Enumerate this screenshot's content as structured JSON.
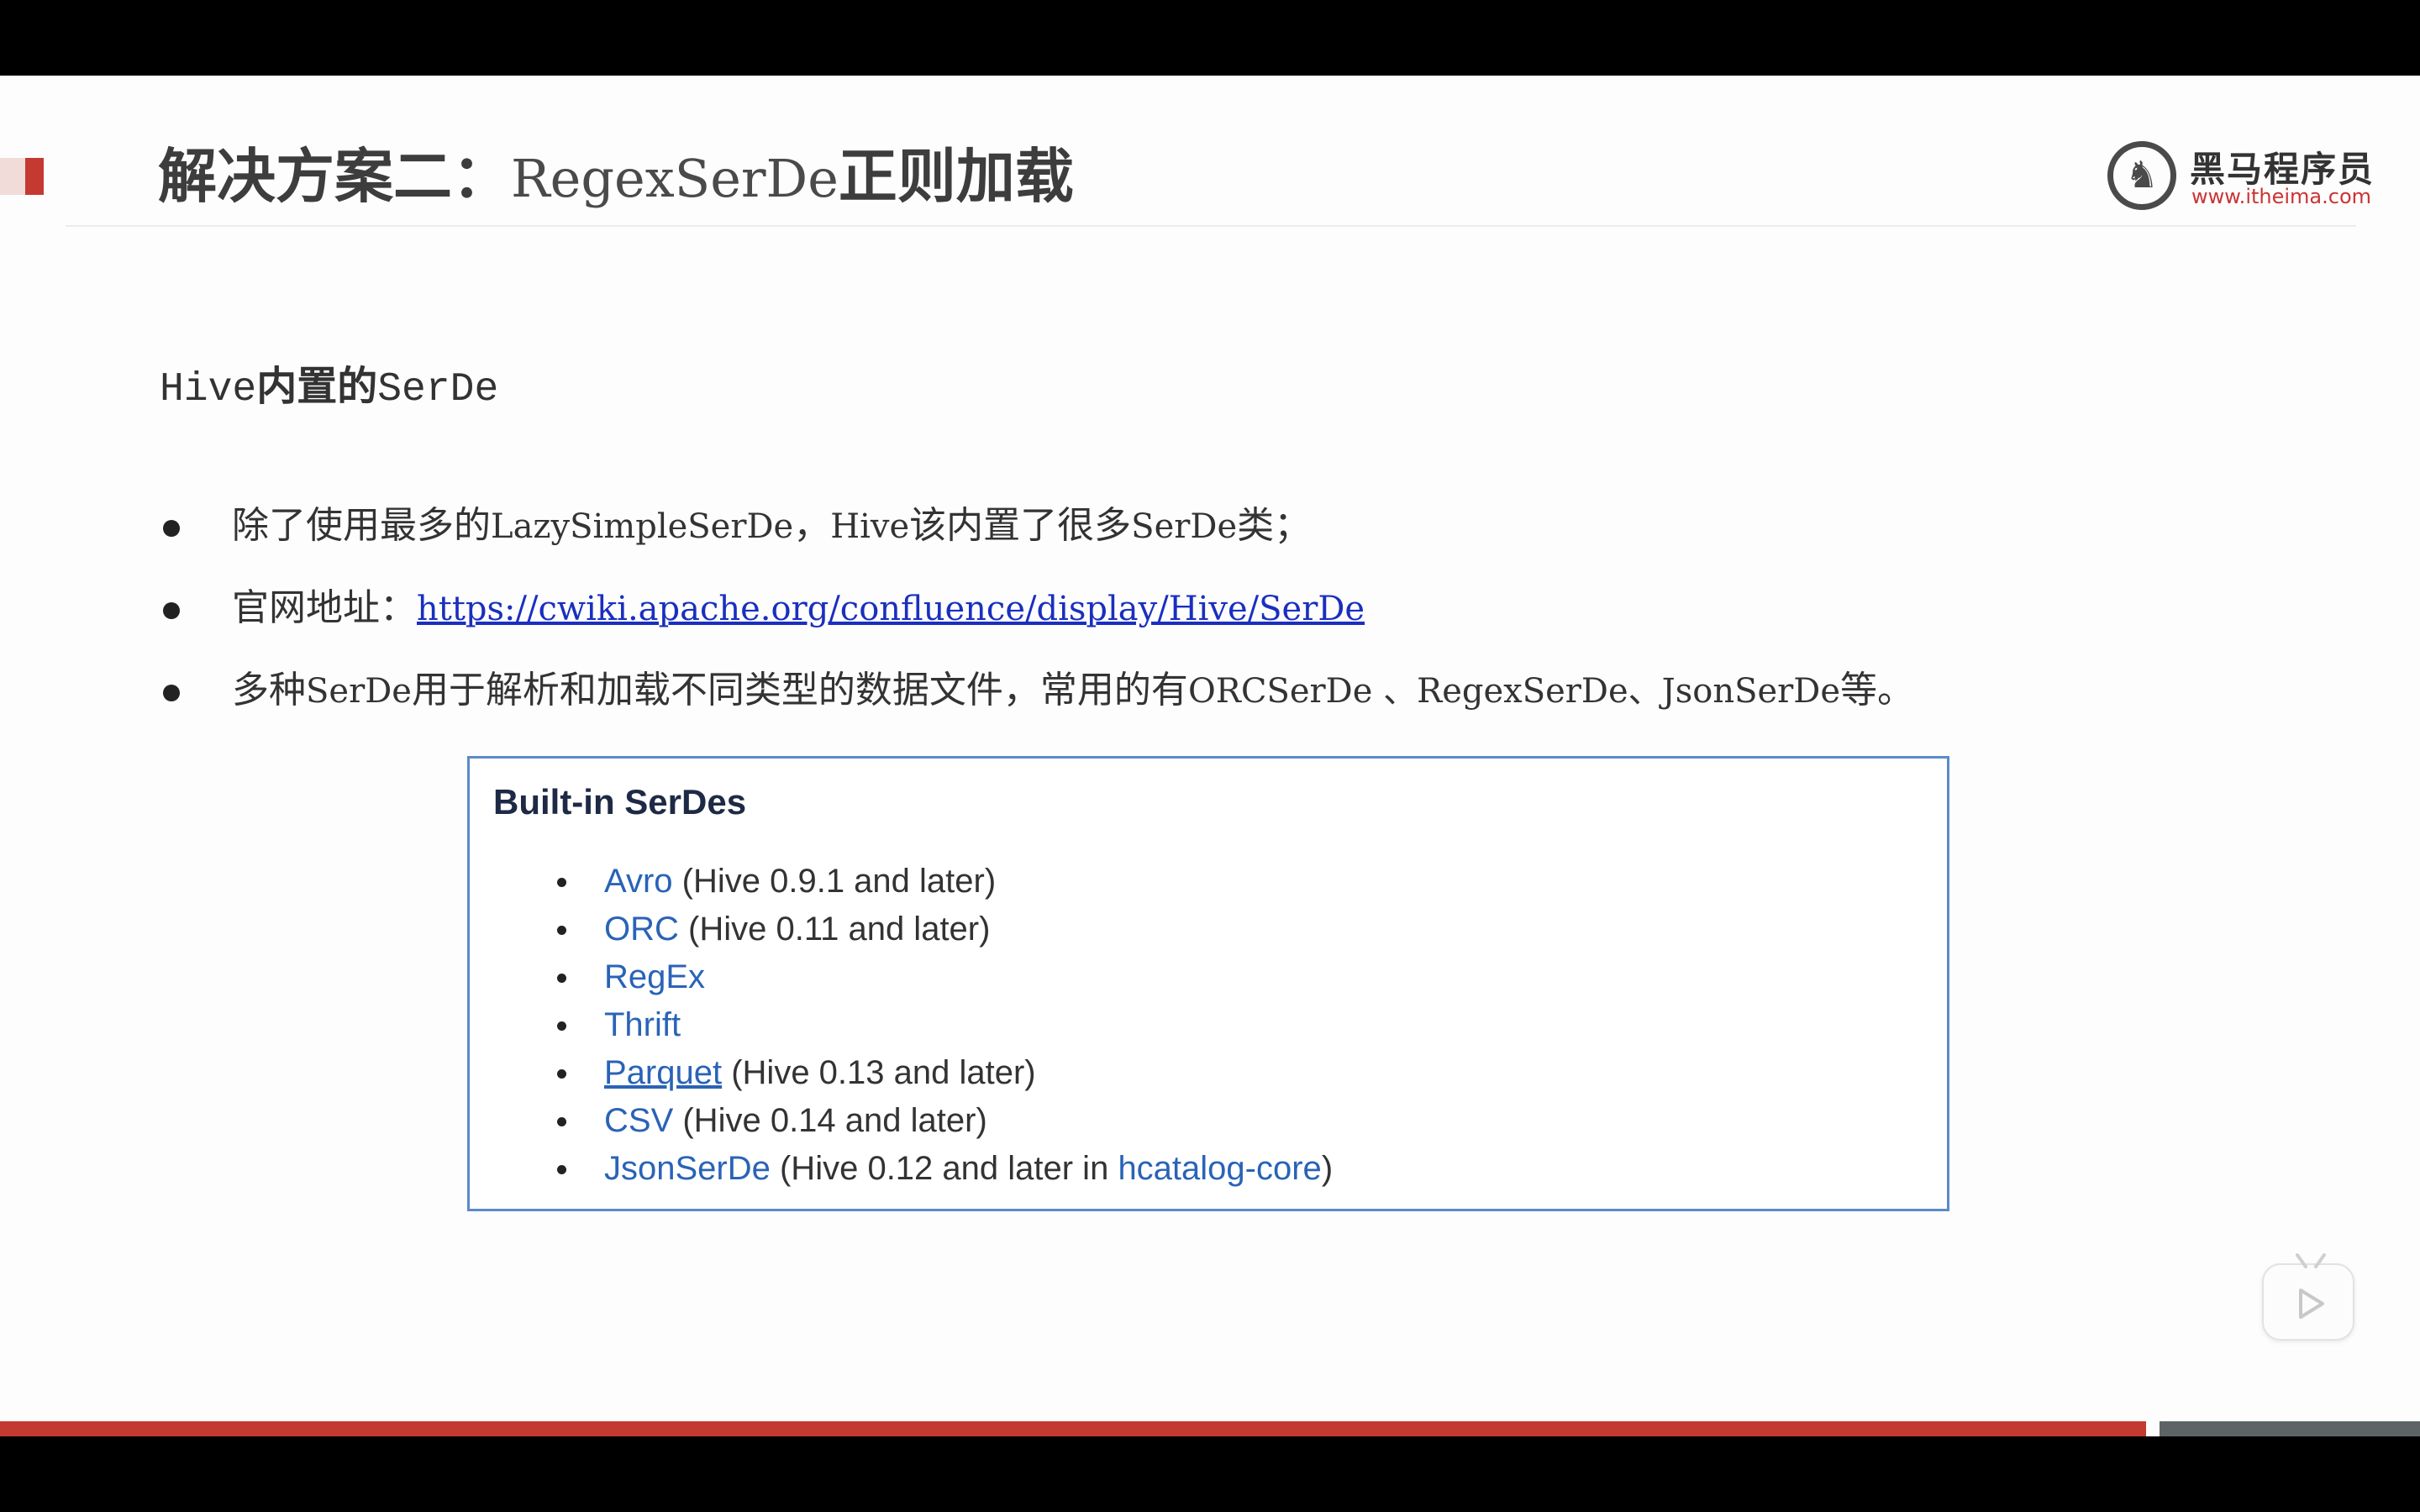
{
  "slide": {
    "title_prefix": "解决方案二：",
    "title_mid": "RegexSerDe",
    "title_suffix": "正则加载",
    "logo": {
      "icon": "horse-icon",
      "name_cn": "黑马程序员",
      "url": "www.itheima.com"
    },
    "subheading": {
      "pre": "Hive",
      "bold": "内置的",
      "post": "SerDe"
    },
    "bullets": [
      {
        "segments": [
          "除了使用最多的",
          "LazySimpleSerDe",
          "，",
          "Hive",
          "该内置了很多",
          "SerDe",
          "类；"
        ]
      },
      {
        "label": "官网地址：",
        "link": "https://cwiki.apache.org/confluence/display/Hive/SerDe"
      },
      {
        "segments": [
          "多种",
          "SerDe",
          "用于解析和加载不同类型的数据文件，常用的有",
          "ORCSerDe 、RegexSerDe、JsonSerDe",
          "等。"
        ]
      }
    ],
    "serdes": {
      "title": "Built-in SerDes",
      "items": [
        {
          "name": "Avro",
          "note": " (Hive 0.9.1 and later)"
        },
        {
          "name": "ORC",
          "note": " (Hive 0.11 and later)"
        },
        {
          "name": "RegEx",
          "note": ""
        },
        {
          "name": "Thrift",
          "note": ""
        },
        {
          "name": "Parquet",
          "note": " (Hive 0.13 and later)"
        },
        {
          "name": "CSV",
          "note": " (Hive 0.14 and later)"
        },
        {
          "name": "JsonSerDe",
          "note": " (Hive 0.12 and later in ",
          "extra_link": "hcatalog-core",
          "tail": ")"
        }
      ]
    }
  },
  "player": {
    "play_icon": "play-icon"
  },
  "colors": {
    "accent_red": "#c43a30",
    "link_blue": "#2a63b7",
    "box_border": "#5b8ac9"
  }
}
